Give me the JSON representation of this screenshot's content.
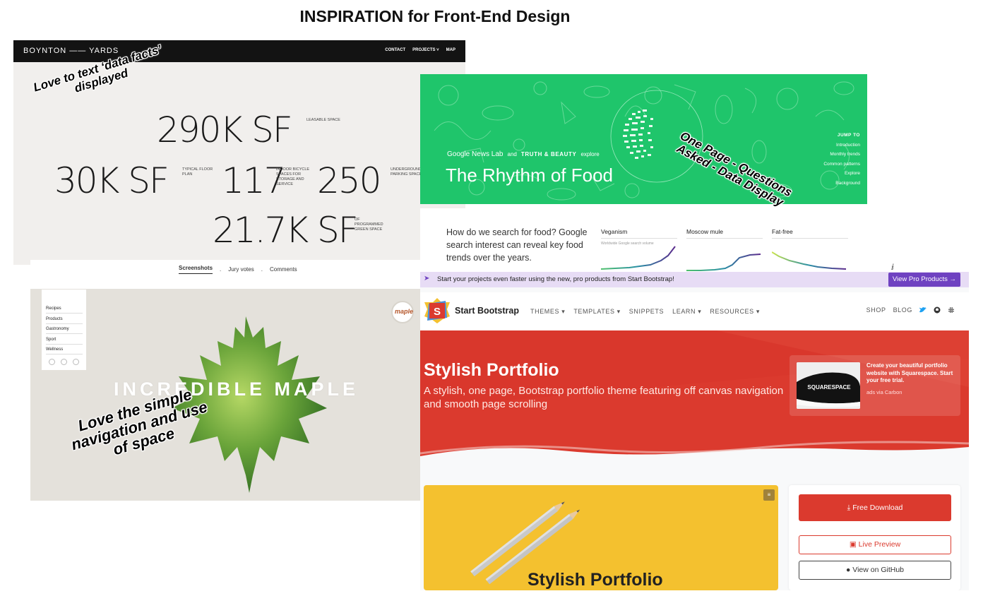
{
  "page_title": "INSPIRATION for Front-End Design",
  "boynton": {
    "logo": "BOYNTON —— YARDS",
    "nav": [
      "CONTACT",
      "PROJECTS ˅",
      "MAP"
    ],
    "stats": [
      {
        "value": "290K SF",
        "caption": "LEASABLE SPACE"
      },
      {
        "value": "30K SF",
        "caption": "TYPICAL FLOOR PLAN"
      },
      {
        "value": "117",
        "caption": "INDOOR BICYCLE SPACES FOR STORAGE AND SERVICE"
      },
      {
        "value": "250",
        "caption": "UNDERGROUND PARKING SPACES"
      },
      {
        "value": "21.7K SF",
        "caption": "OF PROGRAMMED GREEN SPACE"
      }
    ],
    "annotation": "Love to text ‘data facts’ displayed"
  },
  "food": {
    "byline_brand": "Google News Lab",
    "byline_and": "and",
    "byline_partner": "TRUTH & BEAUTY",
    "byline_verb": "explore",
    "title": "The Rhythm of Food",
    "jump_title": "JUMP TO",
    "jump_links": [
      "Introduction",
      "Monthly trends",
      "Common patterns",
      "Explore",
      "Background"
    ],
    "annotation": "One Page - Questions Asked - Data Display",
    "question": "How do we search for food? Google search interest can reveal key food trends over the years.",
    "minis": [
      {
        "label": "Veganism",
        "sub": "Worldwide Google search volume"
      },
      {
        "label": "Moscow mule",
        "sub": ""
      },
      {
        "label": "Fat-free",
        "sub": ""
      }
    ]
  },
  "maple": {
    "tabs": [
      "Screenshots",
      "Jury votes",
      "Comments"
    ],
    "separator": ".",
    "side_items": [
      "Recipes",
      "Products",
      "Gastronomy",
      "Sport",
      "Wellness"
    ],
    "badge": "maple",
    "title": "INCREDIBLE MAPLE",
    "annotation": "Love the simple navigation and use of space"
  },
  "bootstrap": {
    "banner_text": "Start your projects even faster using the new, pro products from Start Bootstrap!",
    "pro_button": "View Pro Products →",
    "logo_letter": "S",
    "brand": "Start Bootstrap",
    "menu": [
      "THEMES ▾",
      "TEMPLATES ▾",
      "SNIPPETS",
      "LEARN ▾",
      "RESOURCES ▾"
    ],
    "menu_right": [
      "SHOP",
      "BLOG"
    ],
    "hero_title": "Stylish Portfolio",
    "hero_subtitle": "A stylish, one page, Bootstrap portfolio theme featuring off canvas navigation and smooth page scrolling",
    "ad_text": "Create your beautiful portfolio website with Squarespace. Start your free trial.",
    "ad_carbon": "ads via Carbon",
    "ad_logo": "SQUARESPACE",
    "card_title": "Stylish Portfolio",
    "free_download": "Free Download",
    "live_preview": "Live Preview",
    "github": "View on GitHub",
    "colors": {
      "accent": "#db3a2e",
      "pro": "#6f42c1",
      "banner": "#e7dcf5"
    }
  }
}
